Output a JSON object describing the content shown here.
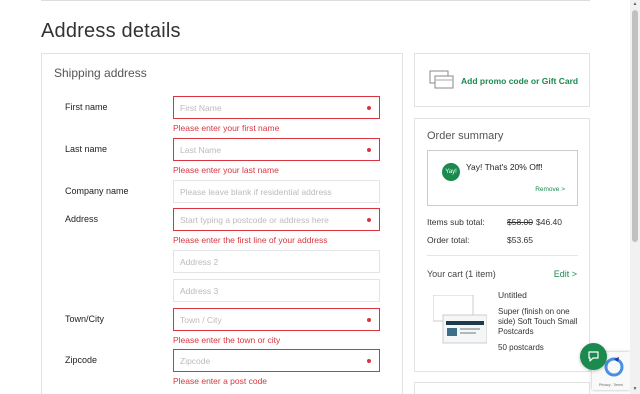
{
  "page": {
    "title": "Address details"
  },
  "shipping": {
    "title": "Shipping address",
    "fields": {
      "first_name": {
        "label": "First name",
        "placeholder": "First Name",
        "error": "Please enter your first name"
      },
      "last_name": {
        "label": "Last name",
        "placeholder": "Last Name",
        "error": "Please enter your last name"
      },
      "company": {
        "label": "Company name",
        "placeholder": "Please leave blank if residential address"
      },
      "address": {
        "label": "Address",
        "placeholder": "Start typing a postcode or address here",
        "error": "Please enter the first line of your address"
      },
      "address2": {
        "placeholder": "Address 2"
      },
      "address3": {
        "placeholder": "Address 3"
      },
      "town": {
        "label": "Town/City",
        "placeholder": "Town / City",
        "error": "Please enter the town or city"
      },
      "zipcode": {
        "label": "Zipcode",
        "placeholder": "Zipcode",
        "error": "Please enter a post code"
      }
    }
  },
  "promo": {
    "link": "Add promo code or Gift Card"
  },
  "summary": {
    "title": "Order summary",
    "yay_badge": "Yay!",
    "yay_text": "Yay! That's 20% Off!",
    "remove": "Remove >",
    "items_label": "Items sub total:",
    "items_old": "$58.00",
    "items_new": "$46.40",
    "total_label": "Order total:",
    "total_value": "$53.65",
    "cart_title": "Your cart (1 item)",
    "edit": "Edit >",
    "product_name": "Untitled",
    "product_desc": "Super (finish on one side) Soft Touch Small Postcards",
    "product_qty": "50 postcards"
  },
  "recaptcha": {
    "text": "Privacy - Terms"
  },
  "colors": {
    "accent": "#1b8a4f",
    "error": "#d9353f"
  }
}
